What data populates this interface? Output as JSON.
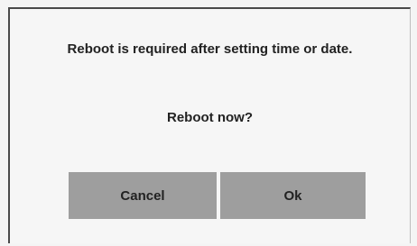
{
  "dialog": {
    "message": "Reboot is required after setting time or date.",
    "question": "Reboot now?",
    "cancel_label": "Cancel",
    "ok_label": "Ok"
  }
}
